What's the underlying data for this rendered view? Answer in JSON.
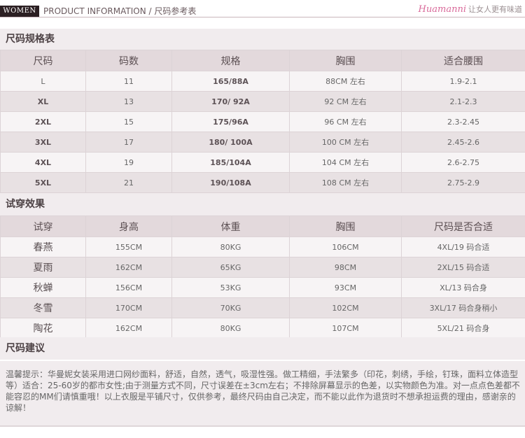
{
  "header": {
    "badge": "WOMEN",
    "title": "PRODUCT INFORMATION /  尺码参考表",
    "brand_script": "Huamanni",
    "brand_slogan": "让女人更有味道"
  },
  "size_table": {
    "title": "尺码规格表",
    "columns": [
      "尺码",
      "码数",
      "规格",
      "胸围",
      "适合腰围"
    ],
    "rows": [
      [
        "L",
        "11",
        "165/88A",
        "88CM 左右",
        "1.9-2.1"
      ],
      [
        "XL",
        "13",
        "170/ 92A",
        "92 CM 左右",
        "2.1-2.3"
      ],
      [
        "2XL",
        "15",
        "175/96A",
        "96 CM 左右",
        "2.3-2.45"
      ],
      [
        "3XL",
        "17",
        "180/ 100A",
        "100 CM 左右",
        "2.45-2.6"
      ],
      [
        "4XL",
        "19",
        "185/104A",
        "104 CM 左右",
        "2.6-2.75"
      ],
      [
        "5XL",
        "21",
        "190/108A",
        "108 CM 左右",
        "2.75-2.9"
      ]
    ]
  },
  "fitting_table": {
    "title": "试穿效果",
    "columns": [
      "试穿",
      "身高",
      "体重",
      "胸围",
      "尺码是否合适"
    ],
    "rows": [
      [
        "春燕",
        "155CM",
        "80KG",
        "106CM",
        "4XL/19 码合适"
      ],
      [
        "夏雨",
        "162CM",
        "65KG",
        "98CM",
        "2XL/15 码合适"
      ],
      [
        "秋蝉",
        "156CM",
        "53KG",
        "93CM",
        "XL/13 码合身"
      ],
      [
        "冬雪",
        "170CM",
        "70KG",
        "102CM",
        "3XL/17 码合身稍小"
      ],
      [
        "陶花",
        "162CM",
        "80KG",
        "107CM",
        "5XL/21 码合身"
      ]
    ]
  },
  "advice": {
    "title": "尺码建议",
    "text": "温馨提示：华曼妮女装采用进口网纱面料，舒适，自然，透气，吸湿性强。做工精细，手法繁多（印花，刺绣，手绘，钉珠，面料立体造型等）适合：25-60岁的都市女性;由于测量方式不同，尺寸误差在±3cm左右；不排除屏幕显示的色差，以实物颜色为准。对一点点色差都不能容忍的MM们请慎重哦！以上衣服是平铺尺寸，仅供参考，最终尺码由自己决定，而不能以此作为退货时不想承担运费的理由，感谢亲的谅解！"
  }
}
